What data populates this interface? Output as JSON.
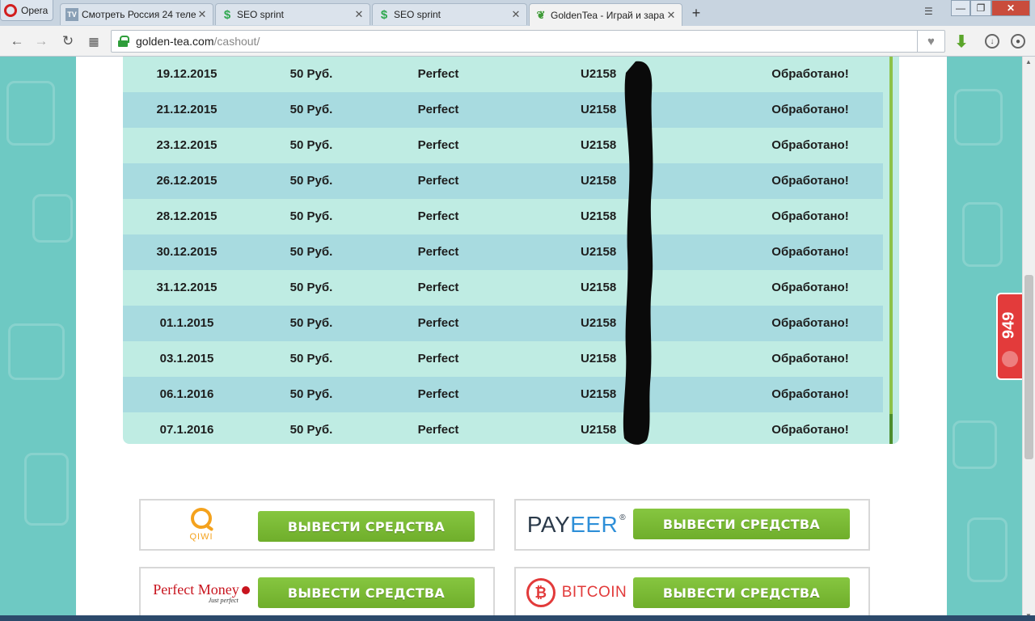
{
  "browser": {
    "menu_label": "Opera",
    "tabs": [
      {
        "title": "Смотреть Россия 24 теле",
        "favicon": "tv-icon"
      },
      {
        "title": "SEO sprint",
        "favicon": "seo-sprint-icon"
      },
      {
        "title": "SEO sprint",
        "favicon": "seo-sprint-icon"
      },
      {
        "title": "GoldenTea - Играй и зара",
        "favicon": "leaf-icon",
        "active": true
      }
    ],
    "url_host": "golden-tea.com",
    "url_path": "/cashout/"
  },
  "table": {
    "rows": [
      {
        "date": "19.12.2015",
        "amount": "50 Руб.",
        "system": "Perfect",
        "account": "U2158",
        "status": "Обработано!"
      },
      {
        "date": "21.12.2015",
        "amount": "50 Руб.",
        "system": "Perfect",
        "account": "U2158",
        "status": "Обработано!"
      },
      {
        "date": "23.12.2015",
        "amount": "50 Руб.",
        "system": "Perfect",
        "account": "U2158",
        "status": "Обработано!"
      },
      {
        "date": "26.12.2015",
        "amount": "50 Руб.",
        "system": "Perfect",
        "account": "U2158",
        "status": "Обработано!"
      },
      {
        "date": "28.12.2015",
        "amount": "50 Руб.",
        "system": "Perfect",
        "account": "U2158",
        "status": "Обработано!"
      },
      {
        "date": "30.12.2015",
        "amount": "50 Руб.",
        "system": "Perfect",
        "account": "U2158",
        "status": "Обработано!"
      },
      {
        "date": "31.12.2015",
        "amount": "50 Руб.",
        "system": "Perfect",
        "account": "U2158",
        "status": "Обработано!"
      },
      {
        "date": "01.1.2015",
        "amount": "50 Руб.",
        "system": "Perfect",
        "account": "U2158",
        "status": "Обработано!"
      },
      {
        "date": "03.1.2015",
        "amount": "50 Руб.",
        "system": "Perfect",
        "account": "U2158",
        "status": "Обработано!"
      },
      {
        "date": "06.1.2016",
        "amount": "50 Руб.",
        "system": "Perfect",
        "account": "U2158",
        "status": "Обработано!"
      },
      {
        "date": "07.1.2016",
        "amount": "50 Руб.",
        "system": "Perfect",
        "account": "U2158",
        "status": "Обработано!"
      }
    ]
  },
  "payments": {
    "qiwi": {
      "logo_text": "QIWI",
      "button": "ВЫВЕСТИ СРЕДСТВА"
    },
    "payeer": {
      "logo_part1": "PAY",
      "logo_part2": "EER",
      "logo_reg": "®",
      "button": "ВЫВЕСТИ СРЕДСТВА"
    },
    "perfect_money": {
      "logo_text": "Perfect Money",
      "logo_sub": "Just perfect",
      "button": "ВЫВЕСТИ СРЕДСТВА"
    },
    "bitcoin": {
      "logo_text": "BITCOIN",
      "logo_symbol": "₿",
      "button": "ВЫВЕСТИ СРЕДСТВА"
    }
  },
  "widget": {
    "counter": "949"
  },
  "colors": {
    "accent_green": "#77b733",
    "row_light": "#bfece3",
    "row_dark": "#a8dbe0",
    "background": "#6ec9c3"
  }
}
